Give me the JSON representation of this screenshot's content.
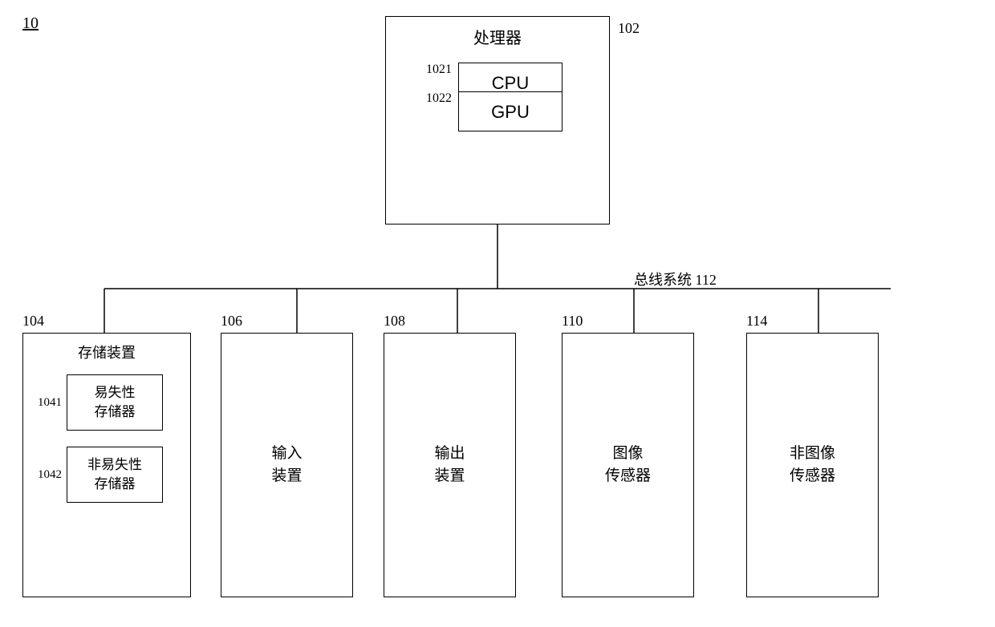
{
  "diagram": {
    "title_label": "10",
    "processor": {
      "label": "处理器",
      "ref": "102",
      "cpu_ref": "1021",
      "cpu_text": "CPU",
      "gpu_ref": "1022",
      "gpu_text": "GPU"
    },
    "bus": {
      "label": "总线系统",
      "ref": "112"
    },
    "nodes": [
      {
        "ref": "104",
        "title": "存储装置",
        "sub1_ref": "1041",
        "sub1_text": "易失性\n存储器",
        "sub2_ref": "1042",
        "sub2_text": "非易失性\n存储器"
      },
      {
        "ref": "106",
        "text": "输入\n装置"
      },
      {
        "ref": "108",
        "text": "输出\n装置"
      },
      {
        "ref": "110",
        "text": "图像\n传感器"
      },
      {
        "ref": "114",
        "text": "非图像\n传感器"
      }
    ]
  }
}
